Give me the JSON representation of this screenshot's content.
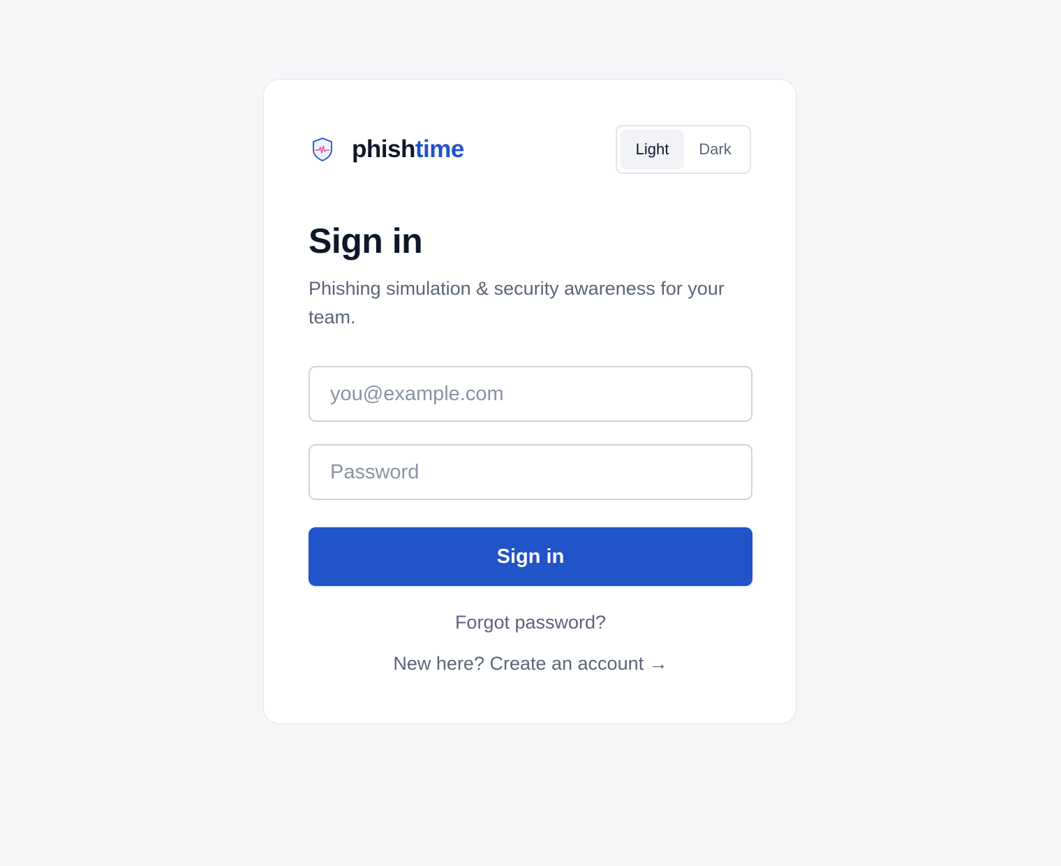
{
  "brand": {
    "name_part1": "phish",
    "name_part2": "time",
    "icon": "shield-heartbeat-icon",
    "accent_color": "#2153c9"
  },
  "theme_toggle": {
    "options": [
      "Light",
      "Dark"
    ],
    "selected": "Light"
  },
  "form": {
    "title": "Sign in",
    "subtitle": "Phishing simulation & security awareness for your team.",
    "email_placeholder": "you@example.com",
    "email_value": "",
    "password_placeholder": "Password",
    "password_value": "",
    "submit_label": "Sign in",
    "submit_color": "#2153c9"
  },
  "links": {
    "forgot_password": "Forgot password?",
    "create_account": "New here? Create an account →"
  }
}
